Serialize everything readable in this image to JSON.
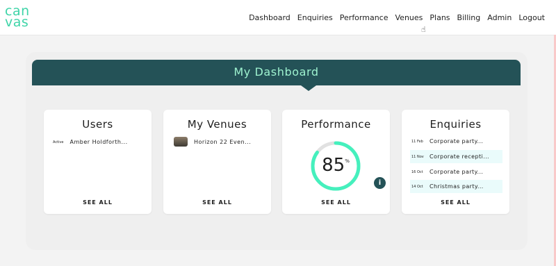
{
  "logo": {
    "line1": "can",
    "line2": "vas"
  },
  "nav": [
    "Dashboard",
    "Enquiries",
    "Performance",
    "Venues",
    "Plans",
    "Billing",
    "Admin",
    "Logout"
  ],
  "dashboard": {
    "title": "My Dashboard"
  },
  "users_card": {
    "title": "Users",
    "item": {
      "status": "Active",
      "name": "Amber Holdforth..."
    },
    "see_all": "SEE ALL"
  },
  "venues_card": {
    "title": "My Venues",
    "item": {
      "name": "Horizon 22 Even..."
    },
    "see_all": "SEE ALL"
  },
  "performance_card": {
    "title": "Performance",
    "value": 85,
    "value_text": "85",
    "unit": "%",
    "info_icon": "i",
    "gauge_color": "#45f0bd",
    "see_all": "SEE ALL"
  },
  "enquiries_card": {
    "title": "Enquiries",
    "items": [
      {
        "date": "11 Feb",
        "text": "Corporate party..."
      },
      {
        "date": "11 Nov",
        "text": "Corporate recepti..."
      },
      {
        "date": "16 Oct",
        "text": "Corporate party..."
      },
      {
        "date": "14 Oct",
        "text": "Christmas party..."
      }
    ],
    "see_all": "SEE ALL"
  },
  "colors": {
    "accent": "#3fd4a8",
    "header": "#245257",
    "header_text": "#9ef2cf"
  }
}
